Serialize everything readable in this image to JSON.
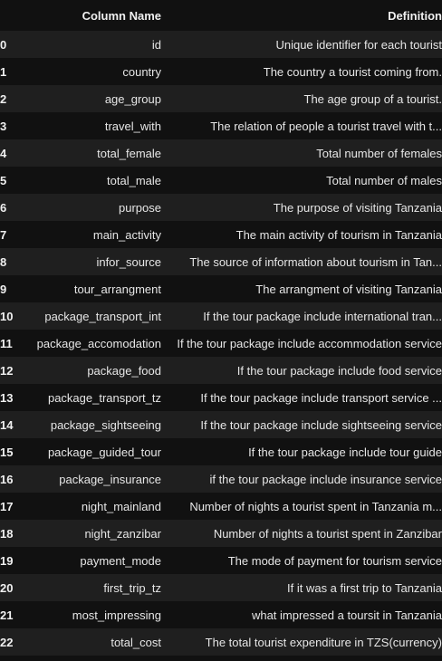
{
  "table": {
    "columns": [
      "",
      "Column Name",
      "Definition"
    ],
    "rows": [
      {
        "index": "0",
        "name": "id",
        "definition": "Unique identifier for each tourist"
      },
      {
        "index": "1",
        "name": "country",
        "definition": "The country a tourist coming from."
      },
      {
        "index": "2",
        "name": "age_group",
        "definition": "The age group of a tourist."
      },
      {
        "index": "3",
        "name": "travel_with",
        "definition": "The relation of people a tourist travel with t..."
      },
      {
        "index": "4",
        "name": "total_female",
        "definition": "Total number of females"
      },
      {
        "index": "5",
        "name": "total_male",
        "definition": "Total number of males"
      },
      {
        "index": "6",
        "name": "purpose",
        "definition": "The purpose of visiting Tanzania"
      },
      {
        "index": "7",
        "name": "main_activity",
        "definition": "The main activity of tourism in Tanzania"
      },
      {
        "index": "8",
        "name": "infor_source",
        "definition": "The source of information about tourism in Tan..."
      },
      {
        "index": "9",
        "name": "tour_arrangment",
        "definition": "The arrangment of visiting Tanzania"
      },
      {
        "index": "10",
        "name": "package_transport_int",
        "definition": "If the tour package include international tran..."
      },
      {
        "index": "11",
        "name": "package_accomodation",
        "definition": "If the tour package include accommodation service"
      },
      {
        "index": "12",
        "name": "package_food",
        "definition": "If the tour package include food service"
      },
      {
        "index": "13",
        "name": "package_transport_tz",
        "definition": "If the tour package include transport service ..."
      },
      {
        "index": "14",
        "name": "package_sightseeing",
        "definition": "If the tour package include sightseeing service"
      },
      {
        "index": "15",
        "name": "package_guided_tour",
        "definition": "If the tour package include tour guide"
      },
      {
        "index": "16",
        "name": "package_insurance",
        "definition": "if the tour package include insurance service"
      },
      {
        "index": "17",
        "name": "night_mainland",
        "definition": "Number of nights a tourist spent in Tanzania m..."
      },
      {
        "index": "18",
        "name": "night_zanzibar",
        "definition": "Number of nights a tourist spent in Zanzibar"
      },
      {
        "index": "19",
        "name": "payment_mode",
        "definition": "The mode of payment for tourism service"
      },
      {
        "index": "20",
        "name": "first_trip_tz",
        "definition": "If it was a first trip to Tanzania"
      },
      {
        "index": "21",
        "name": "most_impressing",
        "definition": "what impressed a toursit in Tanzania"
      },
      {
        "index": "22",
        "name": "total_cost",
        "definition": "The total tourist expenditure in TZS(currency)"
      }
    ]
  }
}
